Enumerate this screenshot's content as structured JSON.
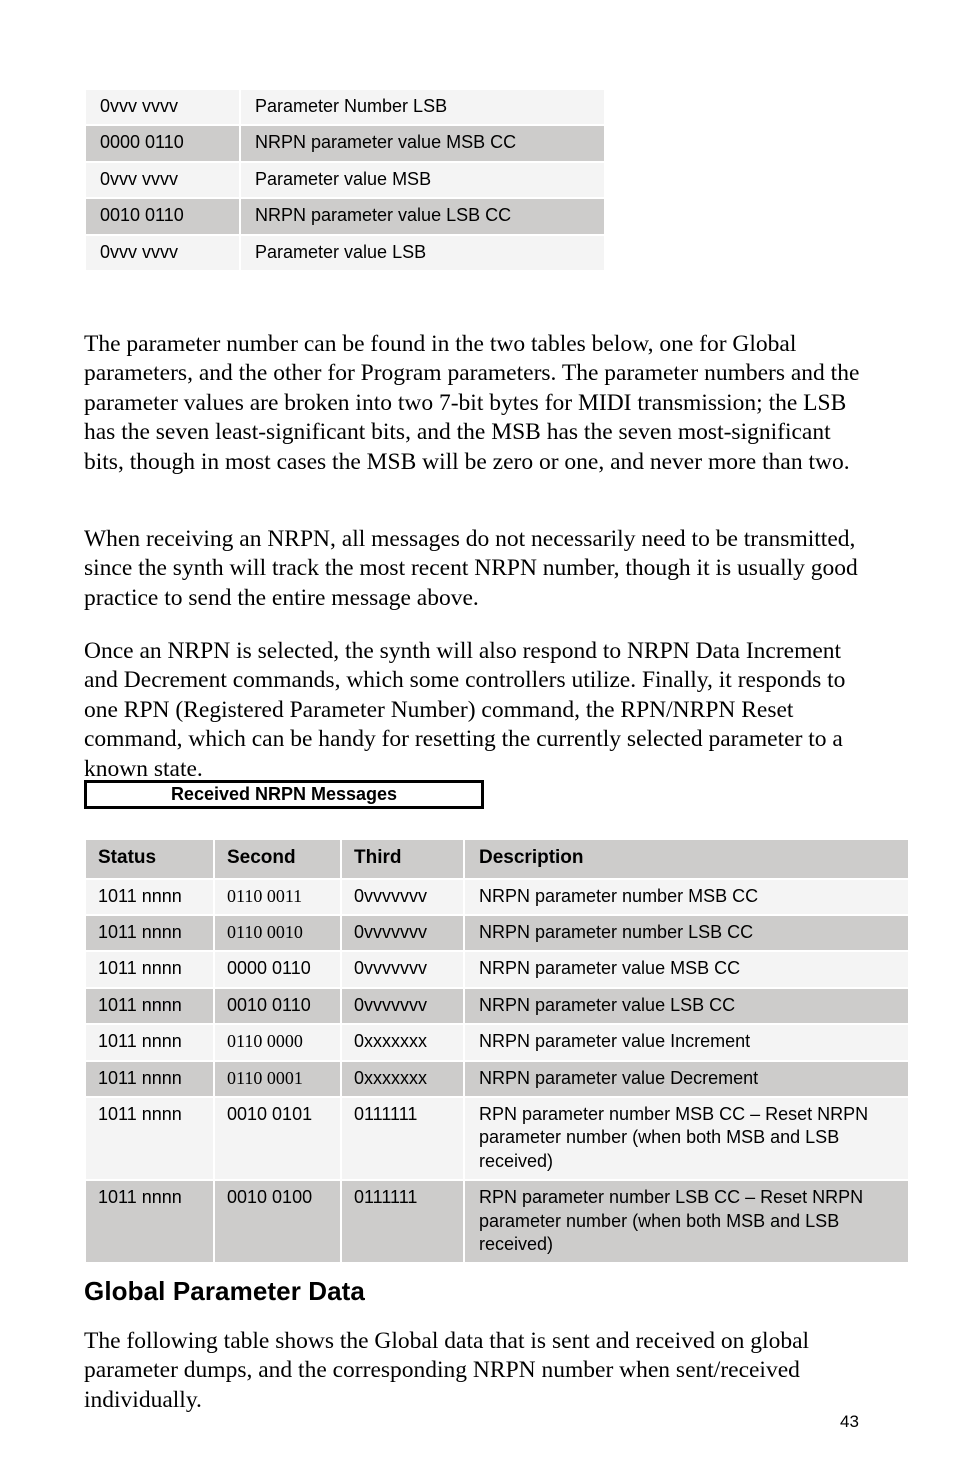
{
  "page": {
    "number": "43"
  },
  "message_table": {
    "rows": [
      {
        "byte": "0vvv vvvv",
        "description": "Parameter Number LSB",
        "shade": "light"
      },
      {
        "byte": "0000 0110",
        "description": "NRPN parameter value MSB CC",
        "shade": "dark"
      },
      {
        "byte": "0vvv vvvv",
        "description": "Parameter value MSB",
        "shade": "light"
      },
      {
        "byte": "0010 0110",
        "description": "NRPN parameter value LSB CC",
        "shade": "dark"
      },
      {
        "byte": "0vvv vvvv",
        "description": "Parameter value LSB",
        "shade": "light"
      }
    ]
  },
  "paragraphs": {
    "p1": "The parameter number can be found in the two tables below, one for Global parameters, and the other for Program parameters. The parameter numbers and the parameter values are broken into two 7-bit bytes for MIDI transmission; the LSB has the seven least-significant bits, and the MSB has the seven most-significant bits, though in most cases the MSB will be zero or one, and never more than two.",
    "p2": "When receiving an NRPN, all messages do not necessarily need to be transmitted, since the synth will track the most recent NRPN number, though it is usually good practice to send the entire message above.",
    "p3": "Once an NRPN is selected, the synth will also respond to NRPN Data Increment and Decrement commands, which some controllers utilize. Finally, it responds to one RPN (Registered Parameter Number) command, the RPN/NRPN Reset command, which can be handy for resetting the currently selected parameter to a known state.",
    "p4": "The following table shows the Global data that is sent and received on global parameter dumps, and the corresponding NRPN number when sent/received individually."
  },
  "caption": {
    "received_nrpn_messages": "Received NRPN Messages"
  },
  "nrpn_table": {
    "headers": {
      "status": "Status",
      "second": "Second",
      "third": "Third",
      "description": "Description"
    },
    "rows": [
      {
        "status": "1011 nnnn",
        "second": "0110 0011",
        "third": "0vvvvvvv",
        "description": "NRPN parameter number MSB CC",
        "shade": "light",
        "second_serif": true
      },
      {
        "status": "1011 nnnn",
        "second": "0110 0010",
        "third": "0vvvvvvv",
        "description": "NRPN parameter number LSB CC",
        "shade": "dark",
        "second_serif": true
      },
      {
        "status": "1011 nnnn",
        "second": "0000 0110",
        "third": "0vvvvvvv",
        "description": "NRPN parameter value MSB CC",
        "shade": "light",
        "second_serif": false
      },
      {
        "status": "1011 nnnn",
        "second": "0010 0110",
        "third": "0vvvvvvv",
        "description": "NRPN parameter value LSB CC",
        "shade": "dark",
        "second_serif": false
      },
      {
        "status": "1011 nnnn",
        "second": "0110 0000",
        "third": "0xxxxxxx",
        "description": "NRPN parameter value Increment",
        "shade": "light",
        "second_serif": true
      },
      {
        "status": "1011 nnnn",
        "second": "0110 0001",
        "third": "0xxxxxxx",
        "description": "NRPN parameter value Decrement",
        "shade": "dark",
        "second_serif": true
      },
      {
        "status": "1011 nnnn",
        "second": "0010 0101",
        "third": "0111111",
        "description": "RPN parameter number MSB CC – Reset NRPN parameter number (when both MSB and LSB received)",
        "shade": "light",
        "second_serif": false
      },
      {
        "status": "1011 nnnn",
        "second": "0010 0100",
        "third": "0111111",
        "description": "RPN parameter number LSB CC – Reset NRPN parameter number (when both MSB and LSB received)",
        "shade": "dark",
        "second_serif": false
      }
    ]
  },
  "headings": {
    "global_parameter_data": "Global Parameter Data"
  },
  "colors": {
    "row_light": "#f4f4f4",
    "row_dark": "#cdcccb",
    "header_fill": "#cdcccb",
    "text": "#000000",
    "page_background": "#ffffff"
  }
}
